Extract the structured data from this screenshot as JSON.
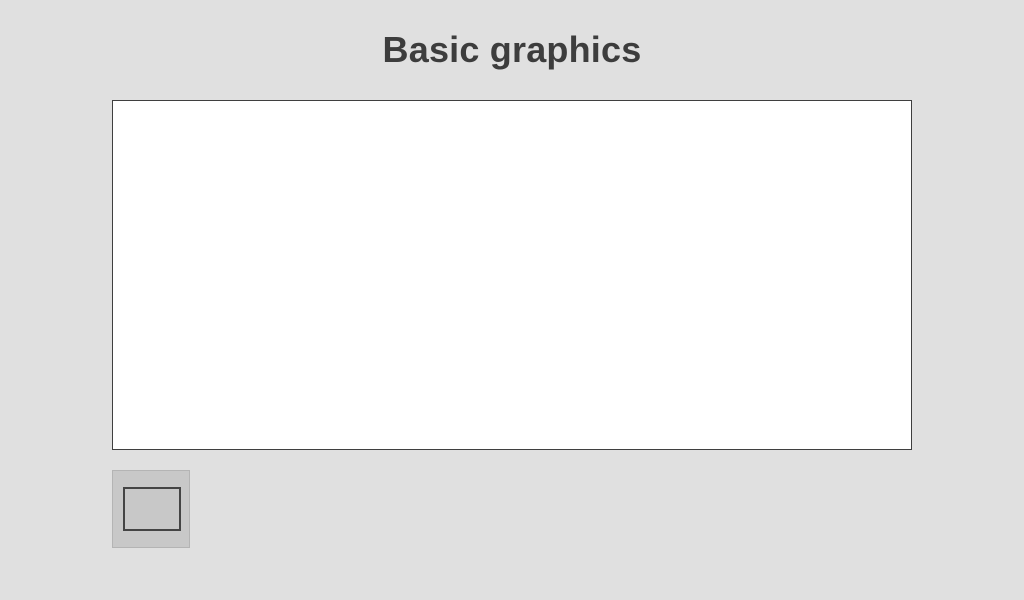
{
  "header": {
    "title": "Basic graphics"
  },
  "toolbar": {
    "tools": [
      {
        "name": "rectangle",
        "icon": "rectangle-icon",
        "selected": true
      }
    ]
  },
  "colors": {
    "background": "#e0e0e0",
    "canvas": "#ffffff",
    "canvas_border": "#3f3f3f",
    "tool_button_bg": "#c8c8c8",
    "icon_stroke": "#444444",
    "title_text": "#3d3d3d"
  }
}
